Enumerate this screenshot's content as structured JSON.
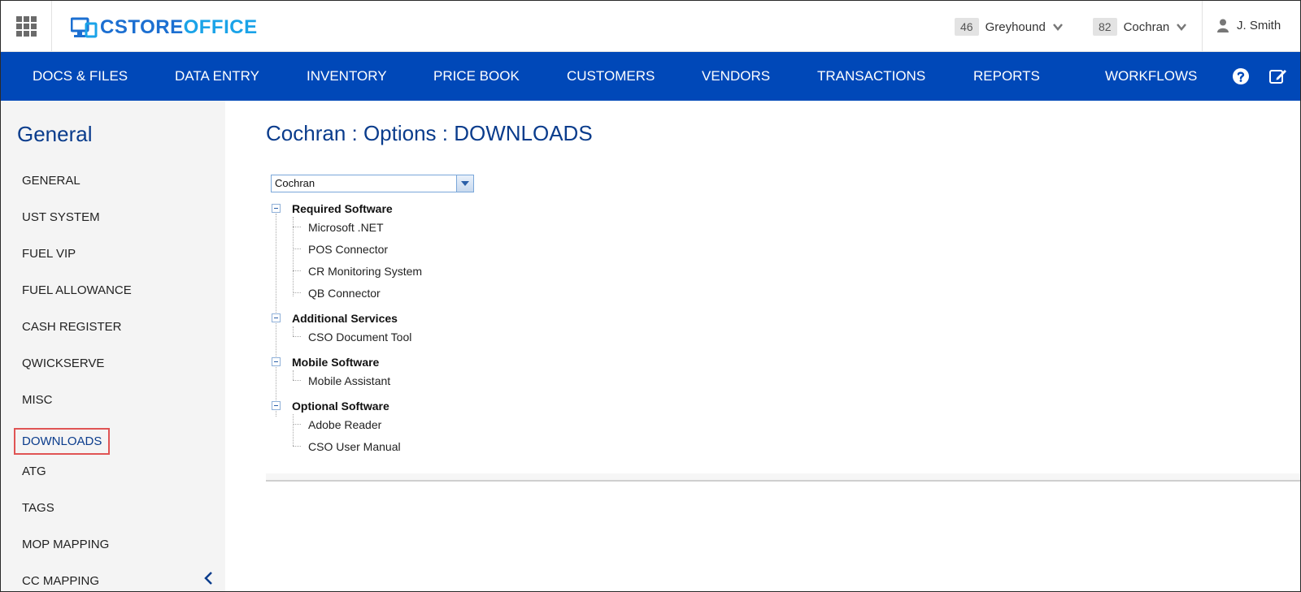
{
  "topbar": {
    "logo": {
      "part1": "CSTORE",
      "part2": "OFFICE"
    },
    "store_selectors": [
      {
        "number": "46",
        "name": "Greyhound"
      },
      {
        "number": "82",
        "name": "Cochran"
      }
    ],
    "user": {
      "name": "J. Smith"
    }
  },
  "nav": {
    "items": [
      "DOCS & FILES",
      "DATA ENTRY",
      "INVENTORY",
      "PRICE BOOK",
      "CUSTOMERS",
      "VENDORS",
      "TRANSACTIONS",
      "REPORTS",
      "WORKFLOWS"
    ],
    "icons": [
      "help-icon",
      "edit-icon"
    ]
  },
  "sidebar": {
    "title": "General",
    "items": [
      "GENERAL",
      "UST SYSTEM",
      "FUEL VIP",
      "FUEL ALLOWANCE",
      "CASH REGISTER",
      "QWICKSERVE",
      "MISC",
      "DOWNLOADS",
      "ATG",
      "TAGS",
      "MOP MAPPING",
      "CC MAPPING"
    ],
    "active": "DOWNLOADS"
  },
  "main": {
    "title": "Cochran : Options : DOWNLOADS",
    "store_combo": {
      "value": "Cochran"
    },
    "tree": [
      {
        "label": "Required Software",
        "children": [
          "Microsoft .NET",
          "POS Connector",
          "CR Monitoring System",
          "QB Connector"
        ]
      },
      {
        "label": "Additional Services",
        "children": [
          "CSO Document Tool"
        ]
      },
      {
        "label": "Mobile Software",
        "children": [
          "Mobile Assistant"
        ]
      },
      {
        "label": "Optional Software",
        "children": [
          "Adobe Reader",
          "CSO User Manual"
        ]
      }
    ]
  },
  "colors": {
    "nav_bg": "#0048b8",
    "title_blue": "#0a3c8c",
    "active_outline": "#e05454"
  }
}
